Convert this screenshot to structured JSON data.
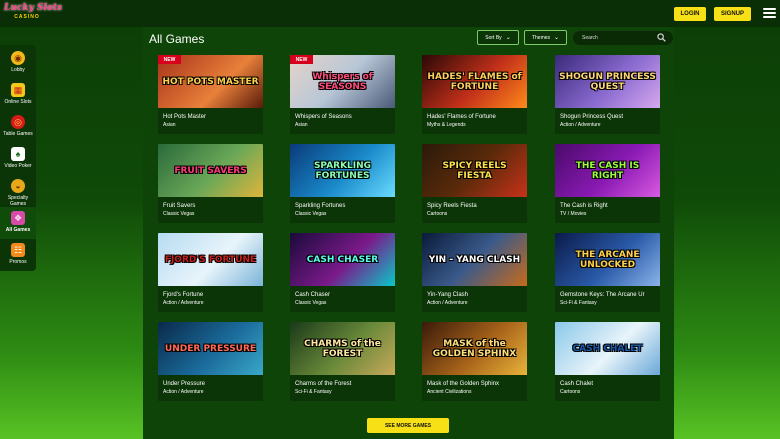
{
  "brand": {
    "logo_line1": "Lucky Slots",
    "logo_line2": "CASINO"
  },
  "header": {
    "login_label": "LOGIN",
    "signup_label": "SIGNUP"
  },
  "sidebar": {
    "items": [
      {
        "label": "Lobby",
        "icon": "lobby-icon",
        "glyph": "◉"
      },
      {
        "label": "Online Slots",
        "icon": "slot-machine-icon",
        "glyph": "▦"
      },
      {
        "label": "Table Games",
        "icon": "roulette-icon",
        "glyph": "◎"
      },
      {
        "label": "Video Poker",
        "icon": "playing-card-icon",
        "glyph": "♠"
      },
      {
        "label": "Specialty Games",
        "icon": "specialty-games-icon",
        "glyph": "◒"
      },
      {
        "label": "All Games",
        "icon": "all-games-icon",
        "glyph": "❖"
      },
      {
        "label": "Promos",
        "icon": "gift-icon",
        "glyph": "☷"
      }
    ]
  },
  "main": {
    "title": "All Games",
    "sort_label": "Sort By",
    "themes_label": "Themes",
    "search_placeholder": "Search",
    "see_more_label": "SEE MORE GAMES"
  },
  "badges": {
    "new_label": "NEW"
  },
  "games": [
    {
      "title": "Hot Pots Master",
      "category": "Asian",
      "art": "HOT POTS MASTER",
      "is_new": true,
      "bg": "linear-gradient(135deg,#a8321a,#e8803a 60%,#5a1a0a)",
      "art_color": "#ffd24a"
    },
    {
      "title": "Whispers of Seasons",
      "category": "Asian",
      "art": "Whispers of SEASONS",
      "is_new": true,
      "bg": "linear-gradient(135deg,#e6d4c8,#b7c6d6 50%,#4a5a78)",
      "art_color": "#ff4a7a"
    },
    {
      "title": "Hades' Flames of Fortune",
      "category": "Myths & Legends",
      "art": "HADES' FLAMES of FORTUNE",
      "is_new": false,
      "bg": "linear-gradient(135deg,#2a0806,#c2301a 55%,#ff8a1a)",
      "art_color": "#ffcf5a"
    },
    {
      "title": "Shogun Princess Quest",
      "category": "Action / Adventure",
      "art": "SHOGUN PRINCESS QUEST",
      "is_new": false,
      "bg": "linear-gradient(135deg,#3a2a7a,#8a6ad0 55%,#d6a8ee)",
      "art_color": "#ffd878"
    },
    {
      "title": "Fruit Savers",
      "category": "Classic Vegas",
      "art": "FRUIT SAVERS",
      "is_new": false,
      "bg": "linear-gradient(135deg,#2a6a3a,#6aa858 55%,#e0b43a)",
      "art_color": "#ff3a7a"
    },
    {
      "title": "Sparkling Fortunes",
      "category": "Classic Vegas",
      "art": "SPARKLING FORTUNES",
      "is_new": false,
      "bg": "linear-gradient(135deg,#0a3a7a,#1a8aca 55%,#6adcff)",
      "art_color": "#8affb4"
    },
    {
      "title": "Spicy Reels Fiesta",
      "category": "Cartoons",
      "art": "SPICY REELS FIESTA",
      "is_new": false,
      "bg": "linear-gradient(135deg,#2a1a0a,#5a2a0a 50%,#c8321a)",
      "art_color": "#ffe24a"
    },
    {
      "title": "The Cash is Right",
      "category": "TV / Movies",
      "art": "THE CASH IS RIGHT",
      "is_new": false,
      "bg": "linear-gradient(135deg,#4a0a6a,#8a1ab4 55%,#d85ae0)",
      "art_color": "#9aff3a"
    },
    {
      "title": "Fjord's Fortune",
      "category": "Action / Adventure",
      "art": "FJORD'S FORTUNE",
      "is_new": false,
      "bg": "linear-gradient(135deg,#b6dcf2,#e8f4fa 55%,#7ab4d8)",
      "art_color": "#c8201a"
    },
    {
      "title": "Cash Chaser",
      "category": "Classic Vegas",
      "art": "CASH CHASER",
      "is_new": false,
      "bg": "linear-gradient(135deg,#1a0a3a,#7a1a8a 55%,#0ac8c8)",
      "art_color": "#5affea"
    },
    {
      "title": "Yin-Yang Clash",
      "category": "Action / Adventure",
      "art": "YIN - YANG CLASH",
      "is_new": false,
      "bg": "linear-gradient(135deg,#0a1a3a,#3a5a8a 50%,#c86a1a)",
      "art_color": "#ffffff"
    },
    {
      "title": "Gemstone Keys: The Arcane Ur",
      "category": "Sci-Fi & Fantasy",
      "art": "THE ARCANE UNLOCKED",
      "is_new": false,
      "bg": "linear-gradient(135deg,#0a1a4a,#2a5aa8 55%,#8ab4ea)",
      "art_color": "#ffd24a"
    },
    {
      "title": "Under Pressure",
      "category": "Action / Adventure",
      "art": "UNDER PRESSURE",
      "is_new": false,
      "bg": "linear-gradient(135deg,#0a2a4a,#1a6a9a 55%,#3aa8c8)",
      "art_color": "#ff6a5a"
    },
    {
      "title": "Charms of the Forest",
      "category": "Sci-Fi & Fantasy",
      "art": "CHARMS of the FOREST",
      "is_new": false,
      "bg": "linear-gradient(135deg,#1a3a1a,#6a8a3a 55%,#c8a85a)",
      "art_color": "#ffe8a0"
    },
    {
      "title": "Mask of the Golden Sphinx",
      "category": "Ancient Civilizations",
      "art": "MASK of the GOLDEN SPHINX",
      "is_new": false,
      "bg": "linear-gradient(135deg,#3a1a0a,#a8641a 55%,#e8b43a)",
      "art_color": "#ffe07a"
    },
    {
      "title": "Cash Chalet",
      "category": "Cartoons",
      "art": "CASH CHALET",
      "is_new": false,
      "bg": "linear-gradient(135deg,#8ac8ea,#e8f4fa 55%,#6aa8d8)",
      "art_color": "#1a5aa8"
    }
  ]
}
